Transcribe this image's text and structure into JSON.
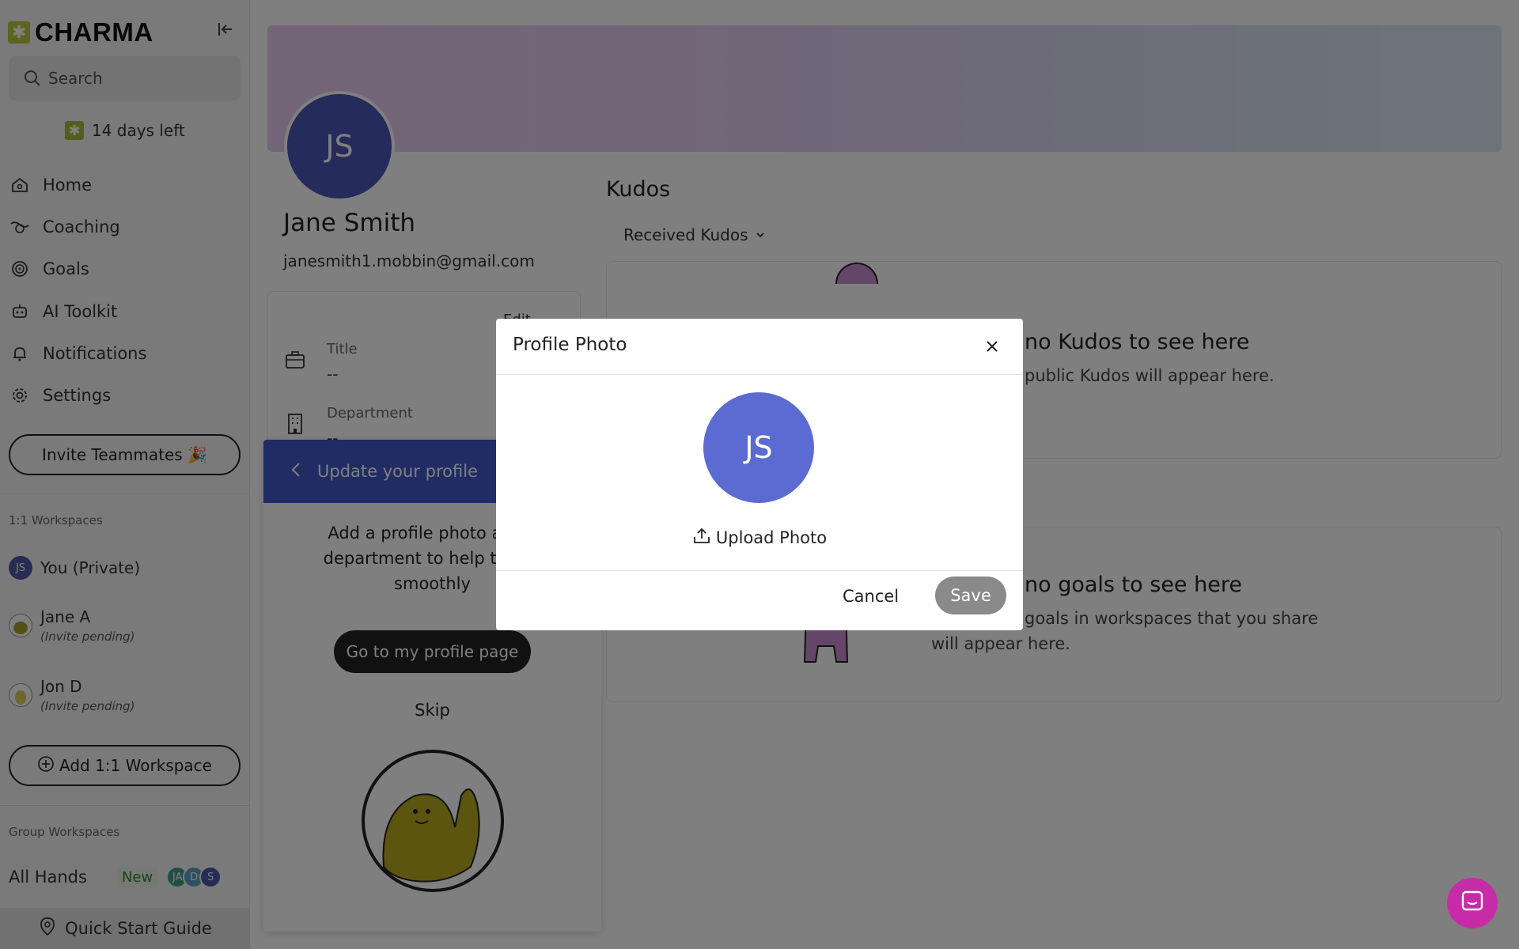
{
  "app": {
    "brand": "CHARMA",
    "accent": "#4358c9",
    "chat_color": "#c62ca7"
  },
  "sidebar": {
    "search_placeholder": "Search",
    "trial_text": "14 days left",
    "nav": [
      {
        "label": "Home",
        "icon": "home-icon"
      },
      {
        "label": "Coaching",
        "icon": "coaching-icon"
      },
      {
        "label": "Goals",
        "icon": "goals-icon"
      },
      {
        "label": "AI Toolkit",
        "icon": "robot-icon"
      },
      {
        "label": "Notifications",
        "icon": "bell-icon"
      },
      {
        "label": "Settings",
        "icon": "gear-icon"
      }
    ],
    "invite_label": "Invite Teammates 🎉",
    "one_on_one_label": "1:1 Workspaces",
    "workspaces": [
      {
        "name": "You (Private)",
        "avatar": "JS"
      },
      {
        "name": "Jane A",
        "status": "(Invite pending)"
      },
      {
        "name": "Jon D",
        "status": "(Invite pending)"
      }
    ],
    "add_workspace_label": "Add 1:1 Workspace",
    "group_label": "Group Workspaces",
    "group": {
      "name": "All Hands",
      "badge": "New",
      "members": [
        "JA",
        "D",
        "S"
      ]
    },
    "quick_start": "Quick Start Guide"
  },
  "profile": {
    "initials": "JS",
    "name": "Jane Smith",
    "email": "janesmith1.mobbin@gmail.com",
    "edit_label": "Edit",
    "fields": [
      {
        "label": "Title",
        "value": "--"
      },
      {
        "label": "Department",
        "value": "--"
      }
    ]
  },
  "kudos": {
    "title": "Kudos",
    "filter": "Received Kudos",
    "empty_title": "no Kudos to see here",
    "empty_text": "public Kudos will appear here."
  },
  "goals": {
    "empty_title": "no goals to see here",
    "empty_text_1": "goals in workspaces that you share",
    "empty_text_2": "will appear here."
  },
  "onboarding": {
    "header": "Update your profile",
    "text_1": "Add a profile photo and s",
    "text_2": "department to help things",
    "text_3": "smoothly",
    "button": "Go to my profile page",
    "skip": "Skip"
  },
  "modal": {
    "title": "Profile Photo",
    "initials": "JS",
    "upload_label": "Upload Photo",
    "cancel_label": "Cancel",
    "save_label": "Save"
  }
}
